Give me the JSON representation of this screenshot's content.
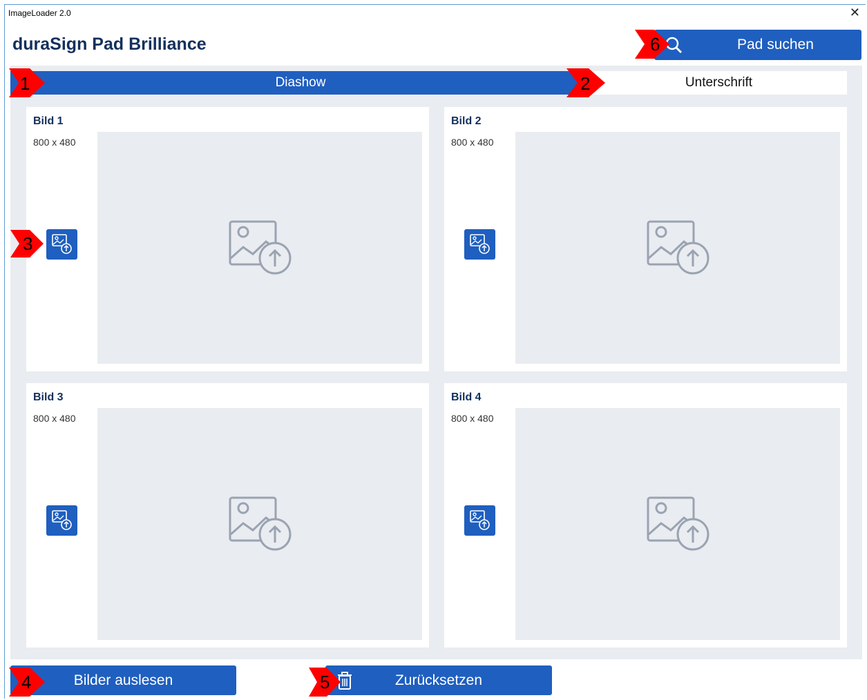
{
  "window": {
    "title": "ImageLoader  2.0",
    "close_glyph": "✕"
  },
  "app": {
    "title": "duraSign Pad Brilliance"
  },
  "header": {
    "search_button_label": "Pad suchen",
    "search_icon": "search-icon"
  },
  "tabs": [
    {
      "label": "Diashow",
      "active": true
    },
    {
      "label": "Unterschrift",
      "active": false
    }
  ],
  "images": [
    {
      "title": "Bild 1",
      "size": "800 x 480"
    },
    {
      "title": "Bild 2",
      "size": "800 x 480"
    },
    {
      "title": "Bild 3",
      "size": "800 x 480"
    },
    {
      "title": "Bild 4",
      "size": "800 x 480"
    }
  ],
  "footer": {
    "read_button_label": "Bilder auslesen",
    "reset_button_label": "Zurücksetzen"
  },
  "markers": [
    "1",
    "2",
    "3",
    "4",
    "5",
    "6"
  ],
  "colors": {
    "accent": "#1f5fbf",
    "panel": "#e9ecf0",
    "marker": "#ff0000",
    "title": "#14305c"
  }
}
